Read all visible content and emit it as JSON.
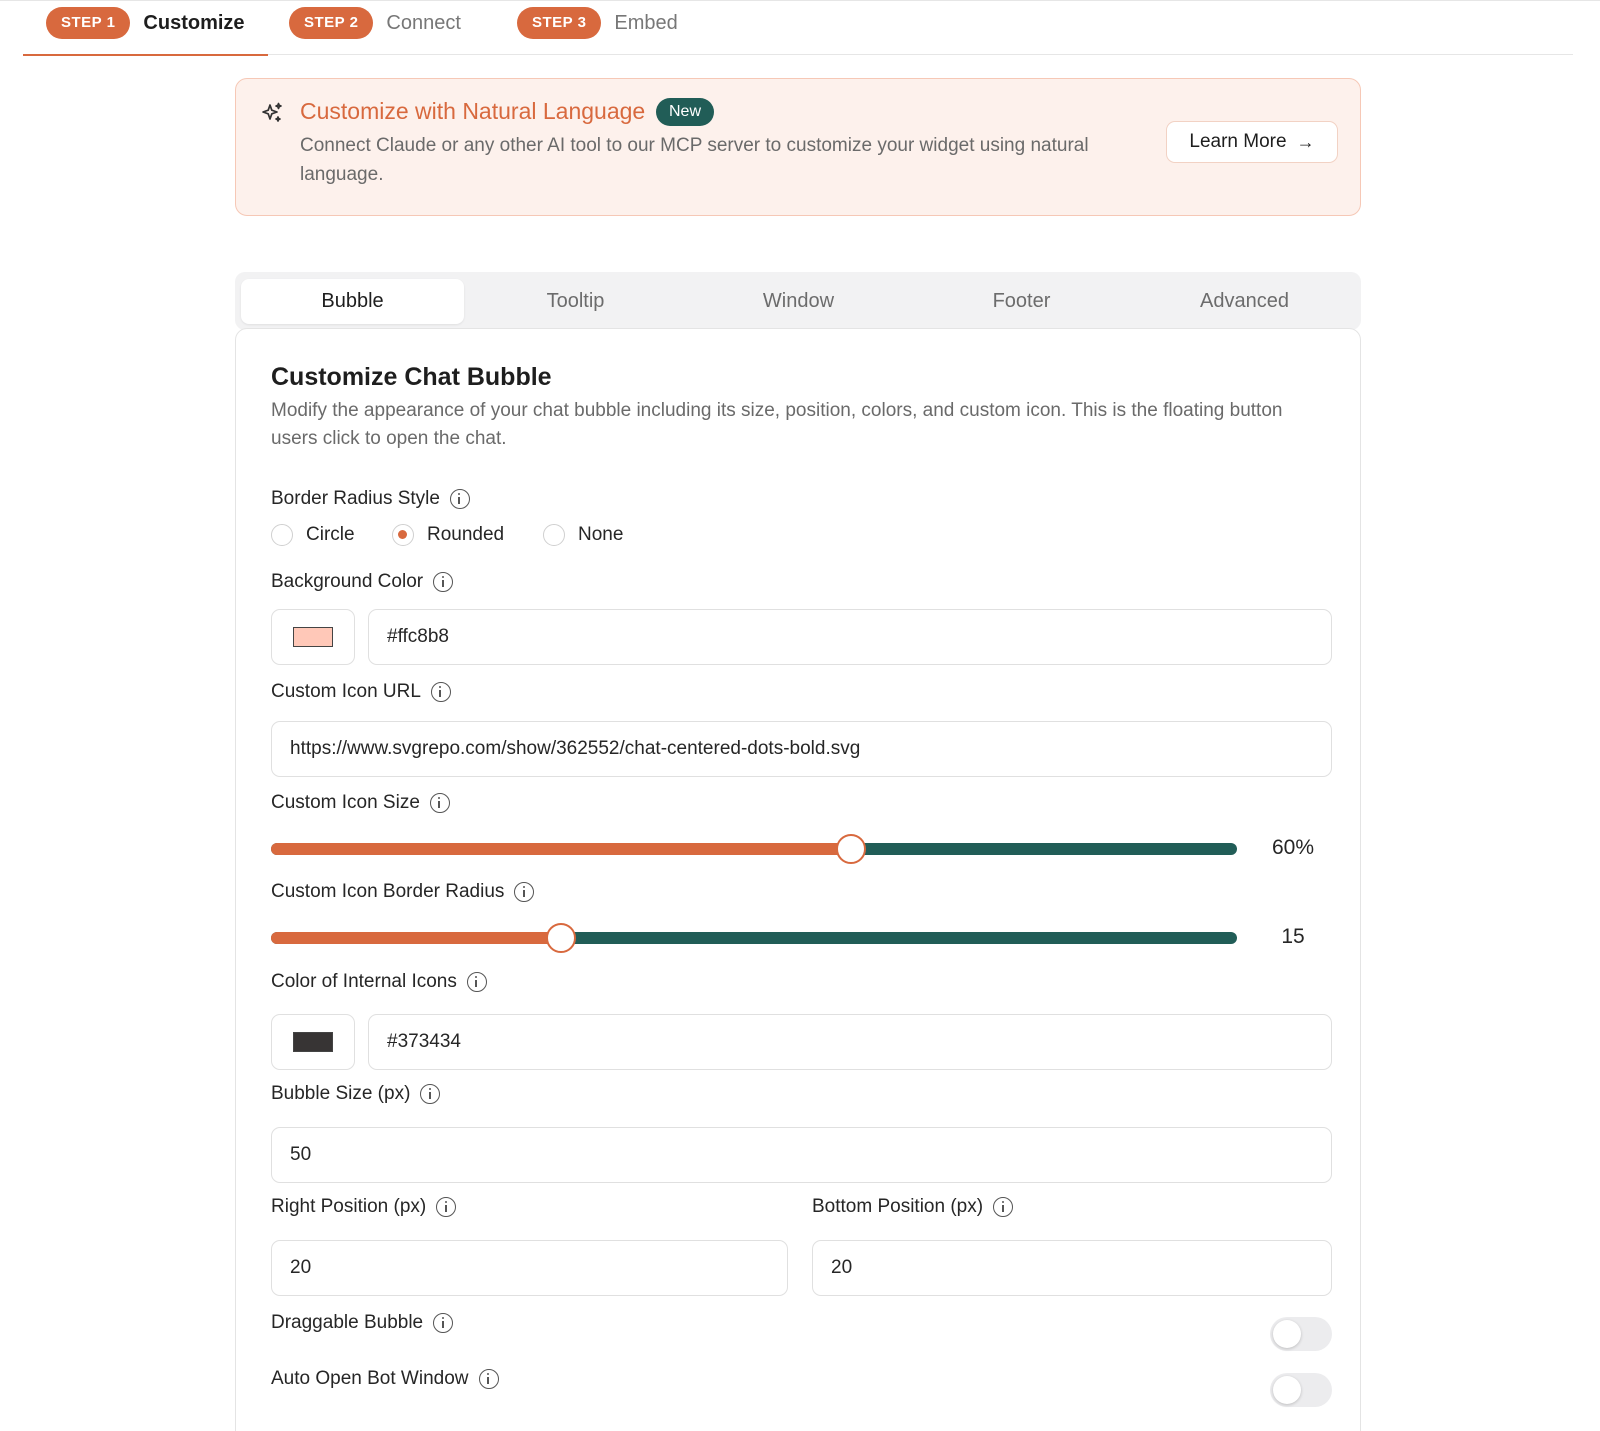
{
  "steps": [
    {
      "badge": "STEP 1",
      "label": "Customize"
    },
    {
      "badge": "STEP 2",
      "label": "Connect"
    },
    {
      "badge": "STEP 3",
      "label": "Embed"
    }
  ],
  "banner": {
    "title": "Customize with Natural Language",
    "badge": "New",
    "description": "Connect Claude or any other AI tool to our MCP server to customize your widget using natural language.",
    "button_label": "Learn More",
    "button_icon": "arrow-right-icon",
    "icon": "sparkles-icon"
  },
  "tabs": [
    {
      "label": "Bubble",
      "active": true
    },
    {
      "label": "Tooltip",
      "active": false
    },
    {
      "label": "Window",
      "active": false
    },
    {
      "label": "Footer",
      "active": false
    },
    {
      "label": "Advanced",
      "active": false
    }
  ],
  "card": {
    "title": "Customize Chat Bubble",
    "description": "Modify the appearance of your chat bubble including its size, position, colors, and custom icon. This is the floating button users click to open the chat."
  },
  "border_radius": {
    "label": "Border Radius Style",
    "options": [
      "Circle",
      "Rounded",
      "None"
    ],
    "selected": "Rounded"
  },
  "background_color": {
    "label": "Background Color",
    "value": "#ffc8b8",
    "swatch": "#ffc8b8"
  },
  "custom_icon_url": {
    "label": "Custom Icon URL",
    "value": "https://www.svgrepo.com/show/362552/chat-centered-dots-bold.svg"
  },
  "custom_icon_size": {
    "label": "Custom Icon Size",
    "display": "60%",
    "fraction": 0.6
  },
  "custom_icon_border_radius": {
    "label": "Custom Icon Border Radius",
    "display": "15",
    "fraction": 0.3
  },
  "internal_icons_color": {
    "label": "Color of Internal Icons",
    "value": "#373434",
    "swatch": "#373434"
  },
  "bubble_size": {
    "label": "Bubble Size (px)",
    "value": "50"
  },
  "right_position": {
    "label": "Right Position (px)",
    "value": "20"
  },
  "bottom_position": {
    "label": "Bottom Position (px)",
    "value": "20"
  },
  "draggable_bubble": {
    "label": "Draggable Bubble",
    "enabled": false
  },
  "auto_open": {
    "label": "Auto Open Bot Window",
    "enabled": false
  },
  "colors": {
    "accent": "#d8693e",
    "teal": "#215d57"
  }
}
